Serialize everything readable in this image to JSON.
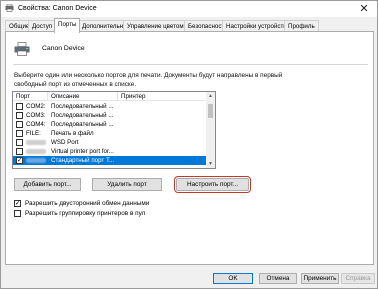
{
  "window": {
    "title": "Свойства: Canon Device",
    "close_glyph": "✕",
    "app_icon": "printer-icon"
  },
  "tabs": [
    {
      "label": "Общие"
    },
    {
      "label": "Доступ"
    },
    {
      "label": "Порты"
    },
    {
      "label": "Дополнительно"
    },
    {
      "label": "Управление цветом"
    },
    {
      "label": "Безопасность"
    },
    {
      "label": "Настройки устройства"
    },
    {
      "label": "Профиль"
    }
  ],
  "active_tab": "Порты",
  "device": {
    "name": "Canon Device",
    "icon": "printer-icon"
  },
  "instructions": "Выберите один или несколько портов для печати. Документы будут направлены в первый свободный порт из отмеченных в списке.",
  "port_list": {
    "columns": [
      "Порт",
      "Описание",
      "Принтер"
    ],
    "rows": [
      {
        "port": "COM2:",
        "description": "Последовательный ...",
        "printer": "",
        "checked": false,
        "selected": false
      },
      {
        "port": "COM3:",
        "description": "Последовательный ...",
        "printer": "",
        "checked": false,
        "selected": false
      },
      {
        "port": "COM4:",
        "description": "Последовательный ...",
        "printer": "",
        "checked": false,
        "selected": false
      },
      {
        "port": "FILE:",
        "description": "Печать в файл",
        "printer": "",
        "checked": false,
        "selected": false
      },
      {
        "port": "",
        "description": "WSD Port",
        "printer": "",
        "checked": false,
        "selected": false
      },
      {
        "port": "",
        "description": "Virtual printer port for...",
        "printer": "",
        "checked": false,
        "selected": false
      },
      {
        "port": "",
        "description": "Стандартный порт T...",
        "printer": "",
        "checked": true,
        "selected": true
      }
    ]
  },
  "buttons": {
    "add_port": "Добавить порт...",
    "delete_port": "Удалить порт",
    "configure_port": "Настроить порт..."
  },
  "options": {
    "bidirectional": {
      "label": "Разрешить двусторонний обмен данными",
      "checked": true
    },
    "pooling": {
      "label": "Разрешить группировку принтеров в пул",
      "checked": false
    }
  },
  "footer": {
    "ok": "OK",
    "cancel": "Отмена",
    "apply": "Применить",
    "help": "Справка"
  }
}
